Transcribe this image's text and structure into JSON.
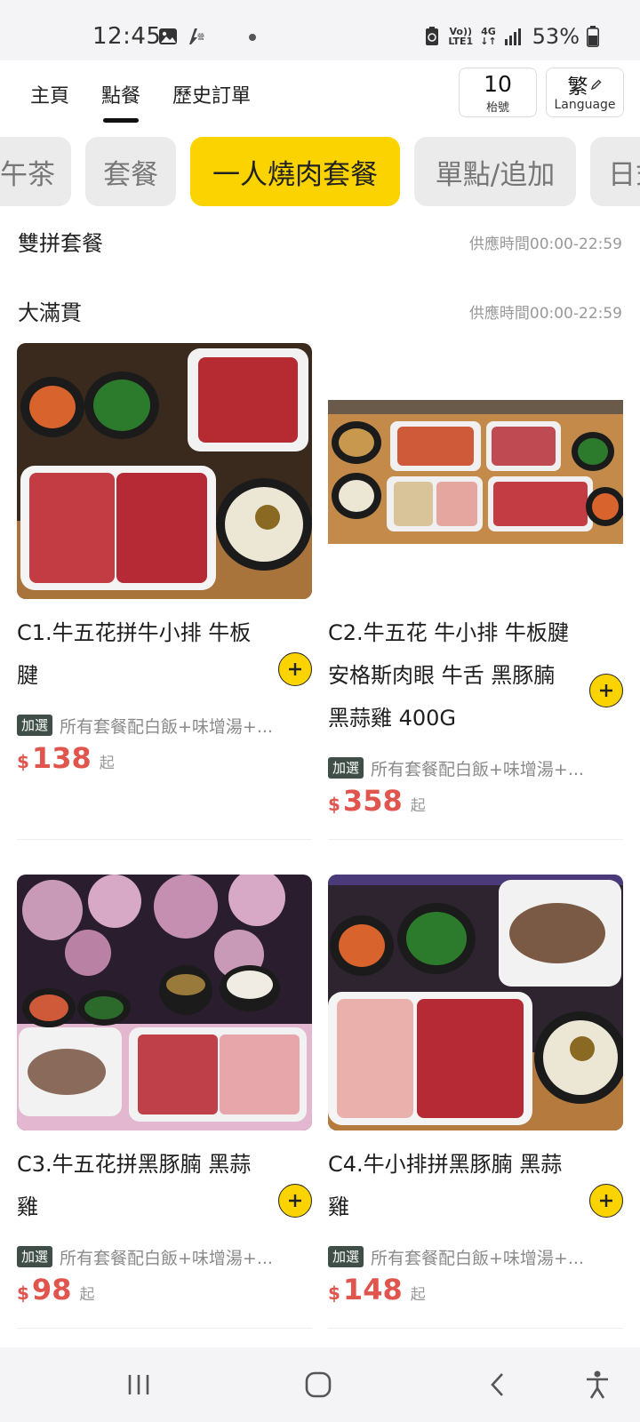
{
  "status_bar": {
    "time": "12:45",
    "volte": "Vo))",
    "lte": "LTE1",
    "network": "4G",
    "battery": "53%"
  },
  "header": {
    "tabs": [
      {
        "label": "主頁",
        "active": false
      },
      {
        "label": "點餐",
        "active": true
      },
      {
        "label": "歷史訂單",
        "active": false
      }
    ],
    "pickup_number": "10",
    "pickup_label": "枱號",
    "language_short": "繁",
    "language_label": "Language"
  },
  "categories": [
    {
      "label": "午茶",
      "active": false
    },
    {
      "label": "套餐",
      "active": false
    },
    {
      "label": "一人燒肉套餐",
      "active": true
    },
    {
      "label": "單點/追加",
      "active": false
    },
    {
      "label": "日式",
      "active": false
    }
  ],
  "sections": [
    {
      "title": "雙拼套餐",
      "time": "供應時間00:00-22:59"
    },
    {
      "title": "大滿貫",
      "time": "供應時間00:00-22:59"
    }
  ],
  "products": [
    {
      "line1": "C1.牛五花拼牛小排 牛板",
      "line2": "腱",
      "line3": "",
      "tag": "加選",
      "desc": "所有套餐配白飯+味增湯+...",
      "currency": "$",
      "price": "138",
      "from": "起"
    },
    {
      "line1": "C2.牛五花 牛小排 牛板腱",
      "line2": "安格斯肉眼 牛舌 黑豚腩",
      "line3": "黑蒜雞 400G",
      "tag": "加選",
      "desc": "所有套餐配白飯+味增湯+...",
      "currency": "$",
      "price": "358",
      "from": "起"
    },
    {
      "line1": "C3.牛五花拼黑豚腩 黑蒜",
      "line2": "雞",
      "line3": "",
      "tag": "加選",
      "desc": "所有套餐配白飯+味增湯+...",
      "currency": "$",
      "price": "98",
      "from": "起"
    },
    {
      "line1": "C4.牛小排拼黑豚腩 黑蒜",
      "line2": "雞",
      "line3": "",
      "tag": "加選",
      "desc": "所有套餐配白飯+味增湯+...",
      "currency": "$",
      "price": "148",
      "from": "起"
    }
  ],
  "colors": {
    "accent": "#fbd400",
    "price": "#e0554d",
    "tag_bg": "#3f4f48",
    "chip_bg": "#ebebeb"
  },
  "icons": {
    "nav_recents": "recents-icon",
    "nav_home": "home-icon",
    "nav_back": "back-icon",
    "nav_accessibility": "accessibility-icon"
  }
}
